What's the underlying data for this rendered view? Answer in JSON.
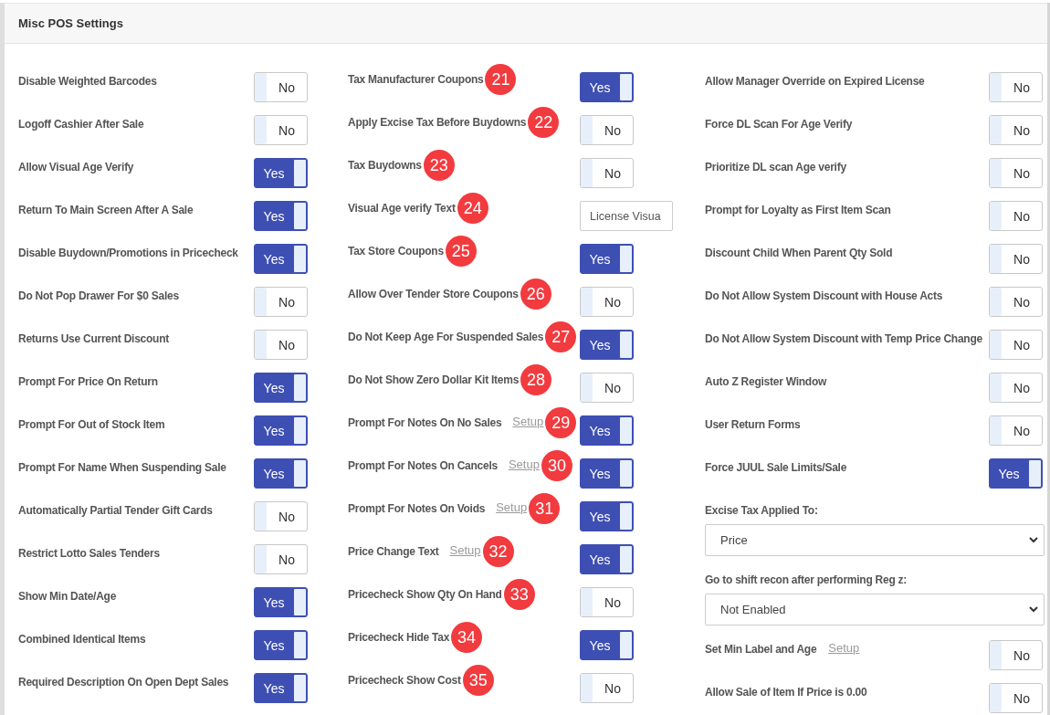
{
  "panel": {
    "title": "Misc POS Settings"
  },
  "columns": [
    {
      "items": [
        {
          "kind": "toggle",
          "label": "Disable Weighted Barcodes",
          "on": false,
          "toggle_text": "No"
        },
        {
          "kind": "toggle",
          "label": "Logoff Cashier After Sale",
          "on": false,
          "toggle_text": "No"
        },
        {
          "kind": "toggle",
          "label": "Allow Visual Age Verify",
          "on": true,
          "toggle_text": "Yes"
        },
        {
          "kind": "toggle",
          "label": "Return To Main Screen After A Sale",
          "on": true,
          "toggle_text": "Yes"
        },
        {
          "kind": "toggle",
          "label": "Disable Buydown/Promotions in Pricecheck",
          "on": true,
          "toggle_text": "Yes"
        },
        {
          "kind": "toggle",
          "label": "Do Not Pop Drawer For $0 Sales",
          "on": false,
          "toggle_text": "No"
        },
        {
          "kind": "toggle",
          "label": "Returns Use Current Discount",
          "on": false,
          "toggle_text": "No"
        },
        {
          "kind": "toggle",
          "label": "Prompt For Price On Return",
          "on": true,
          "toggle_text": "Yes"
        },
        {
          "kind": "toggle",
          "label": "Prompt For Out of Stock Item",
          "on": true,
          "toggle_text": "Yes"
        },
        {
          "kind": "toggle",
          "label": "Prompt For Name When Suspending Sale",
          "on": true,
          "toggle_text": "Yes"
        },
        {
          "kind": "toggle",
          "label": "Automatically Partial Tender Gift Cards",
          "on": false,
          "toggle_text": "No"
        },
        {
          "kind": "toggle",
          "label": "Restrict Lotto Sales Tenders",
          "on": false,
          "toggle_text": "No"
        },
        {
          "kind": "toggle",
          "label": "Show Min Date/Age",
          "on": true,
          "toggle_text": "Yes"
        },
        {
          "kind": "toggle",
          "label": "Combined Identical Items",
          "on": true,
          "toggle_text": "Yes"
        },
        {
          "kind": "toggle",
          "label": "Required Description On Open Dept Sales",
          "on": true,
          "toggle_text": "Yes"
        }
      ]
    },
    {
      "items": [
        {
          "kind": "toggle",
          "label": "Tax Manufacturer Coupons",
          "badge": "21",
          "on": true,
          "toggle_text": "Yes"
        },
        {
          "kind": "toggle",
          "label": "Apply Excise Tax Before Buydowns",
          "badge": "22",
          "on": false,
          "toggle_text": "No"
        },
        {
          "kind": "toggle",
          "label": "Tax Buydowns",
          "badge": "23",
          "on": false,
          "toggle_text": "No"
        },
        {
          "kind": "text",
          "label": "Visual Age verify Text",
          "badge": "24",
          "value": "License Visua"
        },
        {
          "kind": "toggle",
          "label": "Tax Store Coupons",
          "badge": "25",
          "on": true,
          "toggle_text": "Yes"
        },
        {
          "kind": "toggle",
          "label": "Allow Over Tender Store Coupons",
          "badge": "26",
          "on": false,
          "toggle_text": "No"
        },
        {
          "kind": "toggle",
          "label": "Do Not Keep Age For Suspended Sales",
          "badge": "27",
          "on": true,
          "toggle_text": "Yes"
        },
        {
          "kind": "toggle",
          "label": "Do Not Show Zero Dollar Kit Items",
          "badge": "28",
          "on": false,
          "toggle_text": "No"
        },
        {
          "kind": "toggle",
          "label": "Prompt For Notes On No Sales",
          "setup_link": "Setup",
          "badge": "29",
          "on": true,
          "toggle_text": "Yes"
        },
        {
          "kind": "toggle",
          "label": "Prompt For Notes On Cancels",
          "setup_link": "Setup",
          "badge": "30",
          "on": true,
          "toggle_text": "Yes"
        },
        {
          "kind": "toggle",
          "label": "Prompt For Notes On Voids",
          "setup_link": "Setup",
          "badge": "31",
          "on": true,
          "toggle_text": "Yes"
        },
        {
          "kind": "toggle",
          "label": "Price Change Text",
          "setup_link": "Setup",
          "badge": "32",
          "on": true,
          "toggle_text": "Yes"
        },
        {
          "kind": "toggle",
          "label": "Pricecheck Show Qty On Hand",
          "badge": "33",
          "on": false,
          "toggle_text": "No"
        },
        {
          "kind": "toggle",
          "label": "Pricecheck Hide Tax",
          "badge": "34",
          "on": true,
          "toggle_text": "Yes"
        },
        {
          "kind": "toggle",
          "label": "Pricecheck Show Cost",
          "badge": "35",
          "on": false,
          "toggle_text": "No"
        }
      ]
    },
    {
      "items": [
        {
          "kind": "toggle",
          "label": "Allow Manager Override on Expired License",
          "on": false,
          "toggle_text": "No"
        },
        {
          "kind": "toggle",
          "label": "Force DL Scan For Age Verify",
          "on": false,
          "toggle_text": "No"
        },
        {
          "kind": "toggle",
          "label": "Prioritize DL scan Age verify",
          "on": false,
          "toggle_text": "No"
        },
        {
          "kind": "toggle",
          "label": "Prompt for Loyalty as First Item Scan",
          "on": false,
          "toggle_text": "No"
        },
        {
          "kind": "toggle",
          "label": "Discount Child When Parent Qty Sold",
          "on": false,
          "toggle_text": "No"
        },
        {
          "kind": "toggle",
          "label": "Do Not Allow System Discount with House Acts",
          "on": false,
          "toggle_text": "No"
        },
        {
          "kind": "toggle",
          "label": "Do Not Allow System Discount with Temp Price Change",
          "on": false,
          "toggle_text": "No"
        },
        {
          "kind": "toggle",
          "label": "Auto Z Register Window",
          "on": false,
          "toggle_text": "No"
        },
        {
          "kind": "toggle",
          "label": "User Return Forms",
          "on": false,
          "toggle_text": "No"
        },
        {
          "kind": "toggle",
          "label": "Force JUUL Sale Limits/Sale",
          "on": true,
          "toggle_text": "Yes"
        },
        {
          "kind": "select",
          "label": "Excise Tax Applied To:",
          "value": "Price"
        },
        {
          "kind": "select",
          "label": "Go to shift recon after performing Reg z:",
          "value": "Not Enabled"
        },
        {
          "kind": "toggle",
          "label": "Set Min Label and Age",
          "setup_link": "Setup",
          "on": false,
          "toggle_text": "No"
        },
        {
          "kind": "toggle",
          "label": "Allow Sale of Item If Price is 0.00",
          "on": false,
          "toggle_text": "No"
        }
      ]
    }
  ]
}
